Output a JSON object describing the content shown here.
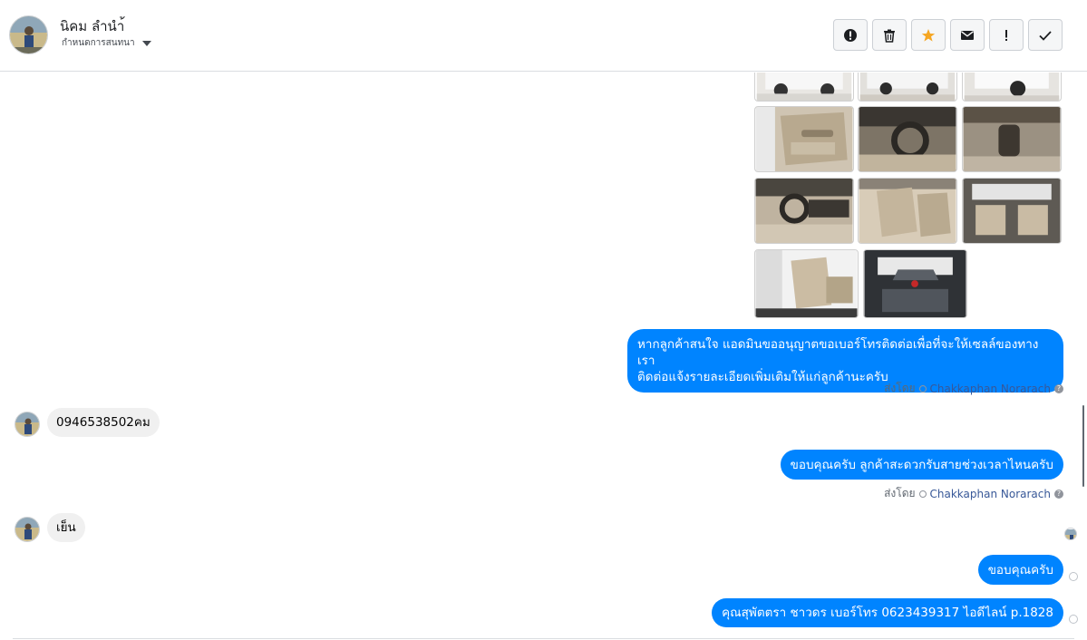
{
  "header": {
    "contact_name": "นิคม ลำนำ้",
    "stage_label": "กำหนดการสนทนา",
    "toolbar": {
      "icons": [
        "alert-circle-icon",
        "trash-icon",
        "star-icon",
        "envelope-icon",
        "exclamation-icon",
        "check-icon"
      ],
      "star_color": "#f5a623"
    }
  },
  "thread": {
    "attachments": {
      "photo_count": 11
    },
    "messages": [
      {
        "direction": "out",
        "lines": [
          "หากลูกค้าสนใจ แอดมินขออนุญาตขอเบอร์โทรติดต่อเพื่อที่จะให้เซลล์ของทางเรา",
          "ติดต่อแจ้งรายละเอียดเพิ่มเติมให้แก่ลูกค้านะครับ"
        ],
        "sent_by_label": "ส่งโดย",
        "sent_by_name": "Chakkaphan Norarach"
      },
      {
        "direction": "in",
        "text": "0946538502คม"
      },
      {
        "direction": "out",
        "text": "ขอบคุณครับ ลูกค้าสะดวกรับสายช่วงเวลาไหนครับ",
        "sent_by_label": "ส่งโดย",
        "sent_by_name": "Chakkaphan Norarach"
      },
      {
        "direction": "in",
        "text": "เย็น"
      },
      {
        "direction": "out",
        "text": "ขอบคุณครับ"
      },
      {
        "direction": "out",
        "text": "คุณสุพัตตรา   ชาวดร     เบอร์โทร 0623439317  ไอดีไลน์ p.1828"
      }
    ],
    "help_glyph": "?",
    "colors": {
      "outgoing_bubble": "#0084ff",
      "incoming_bubble": "#f0f0f0",
      "sender_link": "#385898"
    }
  }
}
